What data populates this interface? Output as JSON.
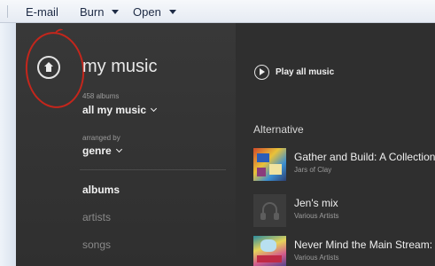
{
  "toolbar": {
    "items": [
      {
        "label": "E-mail"
      },
      {
        "label": "Burn"
      },
      {
        "label": "Open"
      }
    ]
  },
  "library": {
    "title": "my music",
    "album_count": "458 albums",
    "filter_label": "all my music",
    "arranged_by_label": "arranged by",
    "arranged_by_value": "genre",
    "nav": [
      {
        "label": "albums",
        "active": true
      },
      {
        "label": "artists",
        "active": false
      },
      {
        "label": "songs",
        "active": false
      }
    ]
  },
  "content": {
    "play_all_label": "Play all music",
    "section_title": "Alternative",
    "albums": [
      {
        "title": "Gather and Build: A Collection",
        "artist": "Jars of Clay"
      },
      {
        "title": "Jen's mix",
        "artist": "Various Artists"
      },
      {
        "title": "Never Mind the Main Stream:",
        "artist": "Various Artists"
      }
    ]
  },
  "colors": {
    "annotation": "#c4261c",
    "nav_active": "#f2f2f2",
    "nav_inactive": "#8a8a8a"
  }
}
